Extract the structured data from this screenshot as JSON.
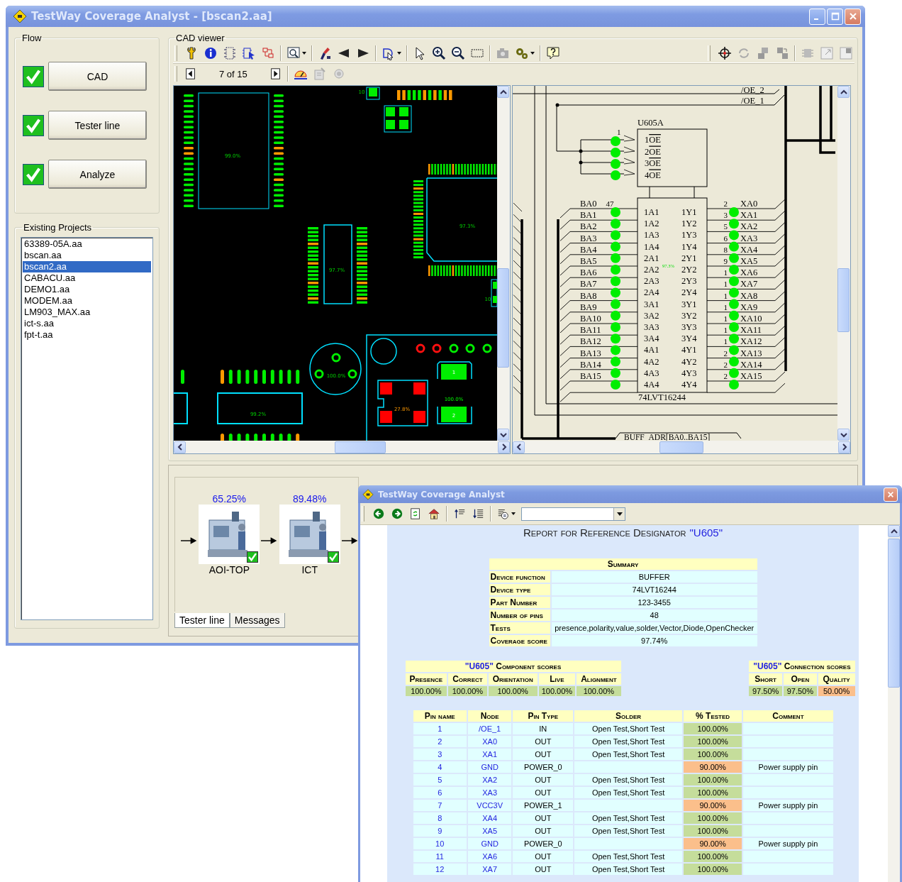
{
  "window": {
    "title": "TestWay Coverage Analyst - [bscan2.aa]"
  },
  "flow": {
    "title": "Flow",
    "steps": [
      {
        "label": "CAD",
        "checked": true
      },
      {
        "label": "Tester line",
        "checked": true
      },
      {
        "label": "Analyze",
        "checked": true
      }
    ]
  },
  "projects": {
    "title": "Existing Projects",
    "items": [
      {
        "name": "63389-05A.aa",
        "selected": false
      },
      {
        "name": "bscan.aa",
        "selected": false
      },
      {
        "name": "bscan2.aa",
        "selected": true
      },
      {
        "name": "CABACU.aa",
        "selected": false
      },
      {
        "name": "DEMO1.aa",
        "selected": false
      },
      {
        "name": "MODEM.aa",
        "selected": false
      },
      {
        "name": "LM903_MAX.aa",
        "selected": false
      },
      {
        "name": "ict-s.aa",
        "selected": false
      },
      {
        "name": "fpt-t.aa",
        "selected": false
      }
    ]
  },
  "cad_viewer": {
    "title": "CAD viewer",
    "page": "7 of 15",
    "board_labels": [
      "10",
      "99.0%",
      "97.3%",
      "97.7%",
      "10",
      "1",
      "100.0%",
      "100.0%",
      "27.8%",
      "99.2%",
      "2"
    ],
    "schematic": {
      "top_nets": [
        "/OE_2",
        "/OE_1"
      ],
      "part_ref": "U605A",
      "enable_pin_number": "1",
      "enable_pins": [
        "1OE",
        "2OE",
        "3OE",
        "4OE"
      ],
      "left_first_pin": "47",
      "left_nets": [
        "BA0",
        "BA1",
        "BA2",
        "BA3",
        "BA4",
        "BA5",
        "BA6",
        "BA7",
        "BA8",
        "BA9",
        "BA10",
        "BA11",
        "BA12",
        "BA13",
        "BA14",
        "BA15"
      ],
      "inputs": [
        "1A1",
        "1A2",
        "1A3",
        "1A4",
        "2A1",
        "2A2",
        "2A3",
        "2A4",
        "3A1",
        "3A2",
        "3A3",
        "3A4",
        "4A1",
        "4A2",
        "4A3",
        "4A4"
      ],
      "outputs": [
        "1Y1",
        "1Y2",
        "1Y3",
        "1Y4",
        "2Y1",
        "2Y2",
        "2Y3",
        "2Y4",
        "3Y1",
        "3Y2",
        "3Y3",
        "3Y4",
        "4Y1",
        "4Y2",
        "4Y3",
        "4Y4"
      ],
      "right_pins": [
        "2",
        "3",
        "5",
        "6",
        "8",
        "9",
        "1",
        "1",
        "1",
        "1",
        "1",
        "1",
        "1",
        "2",
        "2",
        "2"
      ],
      "right_nets": [
        "XA0",
        "XA1",
        "XA2",
        "XA3",
        "XA4",
        "XA5",
        "XA6",
        "XA7",
        "XA8",
        "XA9",
        "XA10",
        "XA11",
        "XA12",
        "XA13",
        "XA14",
        "XA15"
      ],
      "coverage_label": "97.3%",
      "device": "74LVT16244",
      "bus": "BUFF_ADR[BA0..BA15]"
    }
  },
  "tester_line": {
    "stations": [
      {
        "name": "AOI-TOP",
        "coverage": "65.25%",
        "checked": true
      },
      {
        "name": "ICT",
        "coverage": "89.48%",
        "checked": true
      }
    ]
  },
  "bottom_tabs": [
    {
      "label": "Tester line",
      "selected": true
    },
    {
      "label": "Messages",
      "selected": false
    }
  ],
  "report": {
    "title": "TestWay Coverage Analyst",
    "heading": "Report for Reference Designator",
    "designator": "\"U605\"",
    "summary": {
      "title": "Summary",
      "rows": [
        {
          "label": "Device function",
          "value": "BUFFER"
        },
        {
          "label": "Device type",
          "value": "74LVT16244"
        },
        {
          "label": "Part Number",
          "value": "123-3455"
        },
        {
          "label": "Number of pins",
          "value": "48"
        },
        {
          "label": "Tests",
          "value": "presence,polarity,value,solder,Vector,Diode,OpenChecker"
        },
        {
          "label": "Coverage score",
          "value": "97.74%"
        }
      ]
    },
    "component_scores": {
      "designator": "\"U605\"",
      "title": "Component scores",
      "columns": [
        "Presence",
        "Correct",
        "Orientation",
        "Live",
        "Alignment"
      ],
      "values": [
        {
          "text": "100.00%",
          "color": "#c5dd9b"
        },
        {
          "text": "100.00%",
          "color": "#c5dd9b"
        },
        {
          "text": "100.00%",
          "color": "#c5dd9b"
        },
        {
          "text": "100.00%",
          "color": "#c5dd9b"
        },
        {
          "text": "100.00%",
          "color": "#c5dd9b"
        }
      ]
    },
    "connection_scores": {
      "designator": "\"U605\"",
      "title": "Connection scores",
      "columns": [
        "Short",
        "Open",
        "Quality"
      ],
      "values": [
        {
          "text": "97.50%",
          "color": "#c5dd9b"
        },
        {
          "text": "97.50%",
          "color": "#c5dd9b"
        },
        {
          "text": "50.00%",
          "color": "#fbbf8b"
        }
      ]
    },
    "pins": {
      "columns": [
        "Pin name",
        "Node",
        "Pin Type",
        "Solder",
        "% Tested",
        "Comment"
      ],
      "rows": [
        {
          "pin": "1",
          "node": "/OE_1",
          "type": "IN",
          "solder": "Open Test,Short Test",
          "tested": "100.00%",
          "color": "#c5dd9b"
        },
        {
          "pin": "2",
          "node": "XA0",
          "type": "OUT",
          "solder": "Open Test,Short Test",
          "tested": "100.00%",
          "color": "#c5dd9b"
        },
        {
          "pin": "3",
          "node": "XA1",
          "type": "OUT",
          "solder": "Open Test,Short Test",
          "tested": "100.00%",
          "color": "#c5dd9b"
        },
        {
          "pin": "4",
          "node": "GND",
          "type": "POWER_0",
          "tested": "90.00%",
          "color": "#fbbf8b",
          "comment": "Power supply pin"
        },
        {
          "pin": "5",
          "node": "XA2",
          "type": "OUT",
          "solder": "Open Test,Short Test",
          "tested": "100.00%",
          "color": "#c5dd9b"
        },
        {
          "pin": "6",
          "node": "XA3",
          "type": "OUT",
          "solder": "Open Test,Short Test",
          "tested": "100.00%",
          "color": "#c5dd9b"
        },
        {
          "pin": "7",
          "node": "VCC3V",
          "type": "POWER_1",
          "tested": "90.00%",
          "color": "#fbbf8b",
          "comment": "Power supply pin"
        },
        {
          "pin": "8",
          "node": "XA4",
          "type": "OUT",
          "solder": "Open Test,Short Test",
          "tested": "100.00%",
          "color": "#c5dd9b"
        },
        {
          "pin": "9",
          "node": "XA5",
          "type": "OUT",
          "solder": "Open Test,Short Test",
          "tested": "100.00%",
          "color": "#c5dd9b"
        },
        {
          "pin": "10",
          "node": "GND",
          "type": "POWER_0",
          "tested": "90.00%",
          "color": "#fbbf8b",
          "comment": "Power supply pin"
        },
        {
          "pin": "11",
          "node": "XA6",
          "type": "OUT",
          "solder": "Open Test,Short Test",
          "tested": "100.00%",
          "color": "#c5dd9b"
        },
        {
          "pin": "12",
          "node": "XA7",
          "type": "OUT",
          "solder": "Open Test,Short Test",
          "tested": "100.00%",
          "color": "#c5dd9b"
        }
      ]
    }
  }
}
